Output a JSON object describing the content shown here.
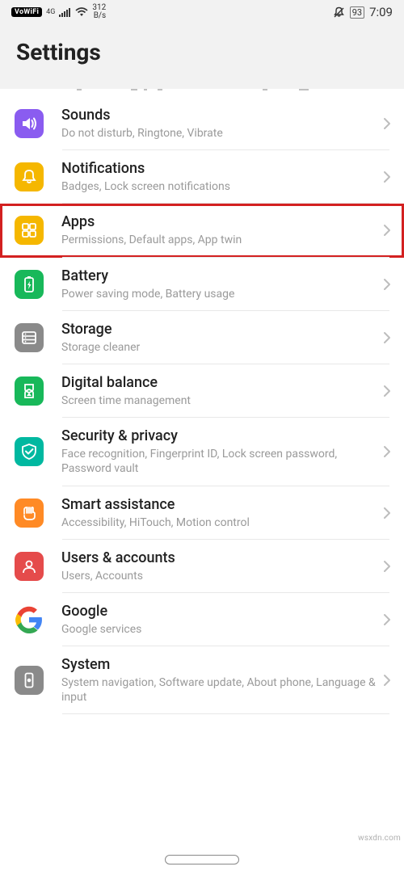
{
  "status": {
    "vowifi": "VoWiFi",
    "net_label": "4G",
    "speed_value": "312",
    "speed_unit": "B/s",
    "battery": "93",
    "time": "7:09"
  },
  "header": {
    "title": "Settings"
  },
  "rows": [
    {
      "id": "sounds",
      "title": "Sounds",
      "subtitle": "Do not disturb, Ringtone, Vibrate",
      "color": "#8a5cf0"
    },
    {
      "id": "notifications",
      "title": "Notifications",
      "subtitle": "Badges, Lock screen notifications",
      "color": "#f5b700"
    },
    {
      "id": "apps",
      "title": "Apps",
      "subtitle": "Permissions, Default apps, App twin",
      "color": "#f5b700",
      "highlight": true
    },
    {
      "id": "battery",
      "title": "Battery",
      "subtitle": "Power saving mode, Battery usage",
      "color": "#18b85a"
    },
    {
      "id": "storage",
      "title": "Storage",
      "subtitle": "Storage cleaner",
      "color": "#8a8a8a"
    },
    {
      "id": "digital-balance",
      "title": "Digital balance",
      "subtitle": "Screen time management",
      "color": "#18b85a"
    },
    {
      "id": "security",
      "title": "Security & privacy",
      "subtitle": "Face recognition, Fingerprint ID, Lock screen password, Password vault",
      "color": "#00b8a0"
    },
    {
      "id": "smart-assistance",
      "title": "Smart assistance",
      "subtitle": "Accessibility, HiTouch, Motion control",
      "color": "#ff8a25"
    },
    {
      "id": "users",
      "title": "Users & accounts",
      "subtitle": "Users, Accounts",
      "color": "#e54b4b"
    },
    {
      "id": "google",
      "title": "Google",
      "subtitle": "Google services",
      "color": "google"
    },
    {
      "id": "system",
      "title": "System",
      "subtitle": "System navigation, Software update, About phone, Language & input",
      "color": "#8a8a8a"
    }
  ],
  "watermark": "wsxdn.com"
}
